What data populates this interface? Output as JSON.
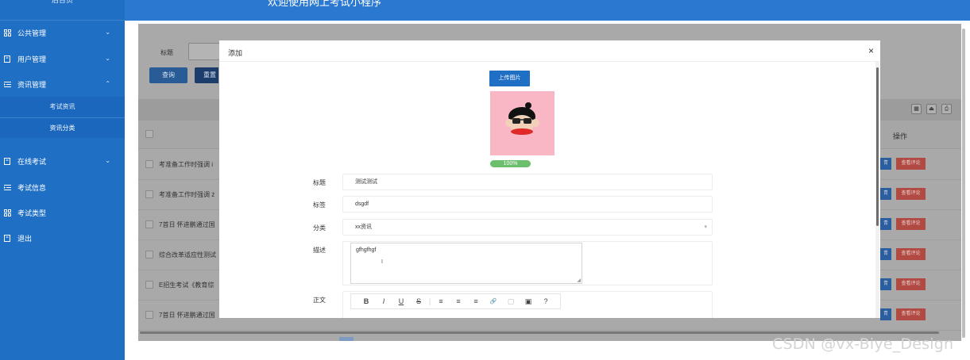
{
  "sidebar": {
    "brand": "后台页",
    "items": [
      {
        "label": "公共管理",
        "icon": "grid-icon",
        "chevron": "⌄"
      },
      {
        "label": "用户管理",
        "icon": "book-icon",
        "chevron": "⌄"
      },
      {
        "label": "资讯管理",
        "icon": "list-icon",
        "chevron": "⌃"
      },
      {
        "label": "在线考试",
        "icon": "book-icon",
        "chevron": "⌄"
      },
      {
        "label": "考试信息",
        "icon": "list-icon"
      },
      {
        "label": "考试类型",
        "icon": "grid-icon"
      },
      {
        "label": "退出",
        "icon": "book-icon"
      }
    ],
    "subitems": [
      {
        "label": "考试资讯"
      },
      {
        "label": "资讯分类"
      }
    ]
  },
  "header": {
    "title": "欢迎使用网上考试小程序"
  },
  "main": {
    "search_label": "标题",
    "query_button": "查询",
    "reset_button": "重置",
    "operation_header": "操作",
    "rows": [
      {
        "text": "考准备工作时强调 i"
      },
      {
        "text": "考准备工作时强调 ż"
      },
      {
        "text": "7首日 怀进鹏通过国"
      },
      {
        "text": "综合改革适应性测试"
      },
      {
        "text": "E招生考试《教育综"
      },
      {
        "text": "7首日 怀进鹏通过国"
      }
    ],
    "row_blue_button": "青",
    "row_red_button": "查看评论"
  },
  "modal": {
    "title": "添加",
    "close": "×",
    "upload_button": "上传图片",
    "progress_text": "100%",
    "progress": 1.0,
    "fields": {
      "title_label": "标题",
      "title_value": "测试测试",
      "tag_label": "标签",
      "tag_value": "dsgdf",
      "category_label": "分类",
      "category_value": "xx资讯",
      "desc_label": "描述",
      "desc_value": "gfhgfhgf",
      "content_label": "正文"
    },
    "toolbar": [
      "B",
      "I",
      "U",
      "S",
      "|",
      "≡",
      "≡",
      "≡",
      "🔗",
      "▢",
      "▣",
      "?"
    ]
  },
  "watermark": "CSDN @vx-Biye_Design",
  "colors": {
    "sidebar": "#1f6fc5",
    "header": "#2a78cf",
    "primary_button": "#1f6fc5",
    "danger_button": "#d9534f",
    "progress": "#6cbf6c",
    "preview_bg": "#f9b7c6"
  }
}
